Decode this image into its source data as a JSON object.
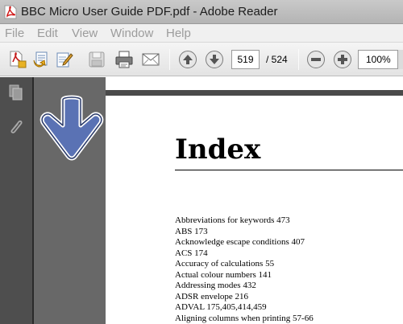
{
  "window": {
    "title": "BBC Micro User Guide PDF.pdf - Adobe Reader"
  },
  "menu": [
    "File",
    "Edit",
    "View",
    "Window",
    "Help"
  ],
  "toolbar": {
    "icons": [
      "create-pdf-icon",
      "open-icon",
      "sign-icon",
      "save-icon",
      "print-icon",
      "email-icon",
      "previous-page-icon",
      "next-page-icon",
      "zoom-out-icon",
      "zoom-in-icon"
    ],
    "page_current": "519",
    "page_total": "/ 524",
    "zoom": "100%"
  },
  "nav_panel": {
    "icons": [
      "pages-icon",
      "attachments-icon"
    ]
  },
  "document": {
    "heading": "Index",
    "entries": [
      "Abbreviations for keywords  473",
      "ABS  173",
      "Acknowledge escape conditions  407",
      "ACS  174",
      "Accuracy of calculations  55",
      "Actual colour numbers  141",
      "Addressing modes  432",
      "ADSR envelope  216",
      "ADVAL  175,405,414,459",
      "Aligning columns when printing  57-66"
    ]
  },
  "colors": {
    "arrow_fill": "#5a72b4",
    "nav_panel": "#4e4e4e",
    "doc_background": "#686868"
  }
}
